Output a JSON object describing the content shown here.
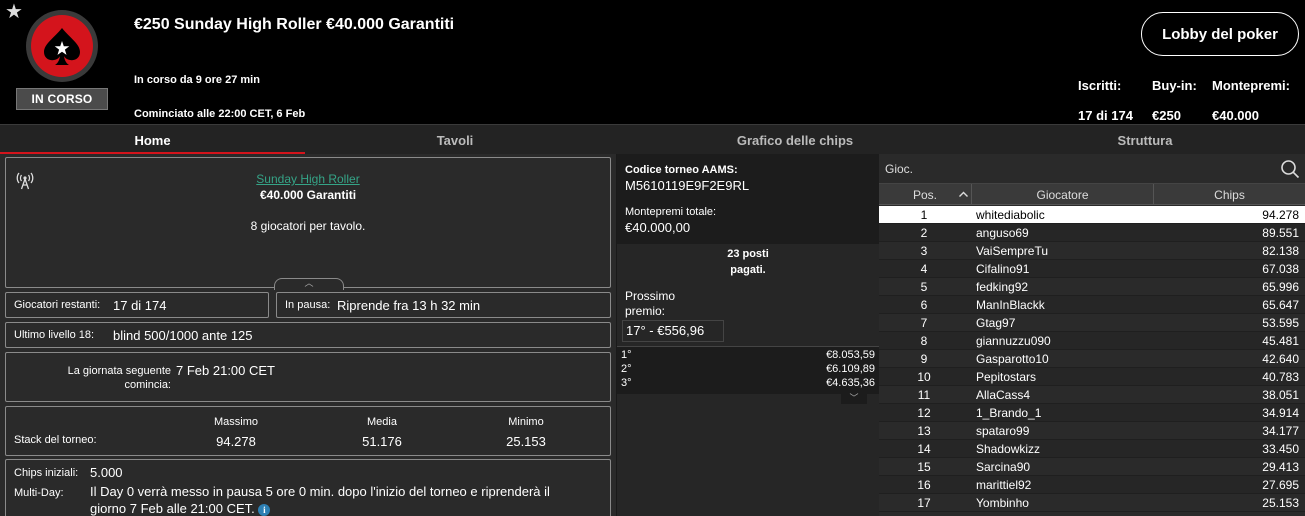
{
  "header": {
    "title": "€250 Sunday High Roller €40.000 Garantiti",
    "running": "In corso da 9 ore 27 min",
    "started": "Cominciato alle 22:00 CET, 6 Feb",
    "status_badge": "IN CORSO",
    "lobby_button": "Lobby del poker",
    "stats": {
      "registered_label": "Iscritti:",
      "registered_value": "17 di 174",
      "buyin_label": "Buy-in:",
      "buyin_value": "€250",
      "prizepool_label": "Montepremi:",
      "prizepool_value": "€40.000"
    }
  },
  "tabs": [
    {
      "label": "Home",
      "active": true
    },
    {
      "label": "Tavoli"
    },
    {
      "label": "Grafico delle chips"
    },
    {
      "label": "Struttura"
    }
  ],
  "info": {
    "link": "Sunday High Roller",
    "guarantee": "€40.000 Garantiti",
    "players_per_table": "8 giocatori per tavolo."
  },
  "remaining": {
    "label": "Giocatori restanti:",
    "value": "17 di 174"
  },
  "pause": {
    "label": "In pausa:",
    "value": "Riprende fra 13 h 32 min"
  },
  "level": {
    "label": "Ultimo livello 18:",
    "value": "blind 500/1000 ante 125"
  },
  "next_day": {
    "label_line1": "La giornata seguente",
    "label_line2": "comincia:",
    "value": "7 Feb 21:00 CET"
  },
  "stack": {
    "label": "Stack del torneo:",
    "max_label": "Massimo",
    "max_value": "94.278",
    "avg_label": "Media",
    "avg_value": "51.176",
    "min_label": "Minimo",
    "min_value": "25.153"
  },
  "chips": {
    "initial_label": "Chips iniziali:",
    "initial_value": "5.000",
    "multiday_label": "Multi-Day:",
    "multiday_line1": "Il Day 0 verrà messo in pausa 5 ore 0 min. dopo l'inizio del torneo e riprenderà il",
    "multiday_line2": "giorno 7 Feb alle 21:00 CET."
  },
  "middle": {
    "aams_label": "Codice torneo AAMS:",
    "aams_code": "M5610119E9F2E9RL",
    "total_label": "Montepremi totale:",
    "total_value": "€40.000,00",
    "paid_line1": "23 posti",
    "paid_line2": "pagati.",
    "next_label_line1": "Prossimo",
    "next_label_line2": "premio:",
    "next_value": "17° - €556,96",
    "payouts": [
      {
        "pos": "1°",
        "amount": "€8.053,59"
      },
      {
        "pos": "2°",
        "amount": "€6.109,89"
      },
      {
        "pos": "3°",
        "amount": "€4.635,36"
      }
    ]
  },
  "players": {
    "search_placeholder": "Gioc.",
    "col_pos": "Pos.",
    "col_player": "Giocatore",
    "col_chips": "Chips",
    "rows": [
      {
        "pos": "1",
        "name": "whitediabolic",
        "chips": "94.278"
      },
      {
        "pos": "2",
        "name": "anguso69",
        "chips": "89.551"
      },
      {
        "pos": "3",
        "name": "VaiSempreTu",
        "chips": "82.138"
      },
      {
        "pos": "4",
        "name": "Cifalino91",
        "chips": "67.038"
      },
      {
        "pos": "5",
        "name": "fedking92",
        "chips": "65.996"
      },
      {
        "pos": "6",
        "name": "ManInBlackk",
        "chips": "65.647"
      },
      {
        "pos": "7",
        "name": "Gtag97",
        "chips": "53.595"
      },
      {
        "pos": "8",
        "name": "giannuzzu090",
        "chips": "45.481"
      },
      {
        "pos": "9",
        "name": "Gasparotto10",
        "chips": "42.640"
      },
      {
        "pos": "10",
        "name": "Pepitostars",
        "chips": "40.783"
      },
      {
        "pos": "11",
        "name": "AllaCass4",
        "chips": "38.051"
      },
      {
        "pos": "12",
        "name": "1_Brando_1",
        "chips": "34.914"
      },
      {
        "pos": "13",
        "name": "spataro99",
        "chips": "34.177"
      },
      {
        "pos": "14",
        "name": "Shadowkizz",
        "chips": "33.450"
      },
      {
        "pos": "15",
        "name": "Sarcina90",
        "chips": "29.413"
      },
      {
        "pos": "16",
        "name": "marittiel92",
        "chips": "27.695"
      },
      {
        "pos": "17",
        "name": "Yombinho",
        "chips": "25.153"
      }
    ]
  },
  "colors": {
    "accent": "#d4141c",
    "link": "#35a487",
    "info_icon": "#2d7fb3"
  }
}
